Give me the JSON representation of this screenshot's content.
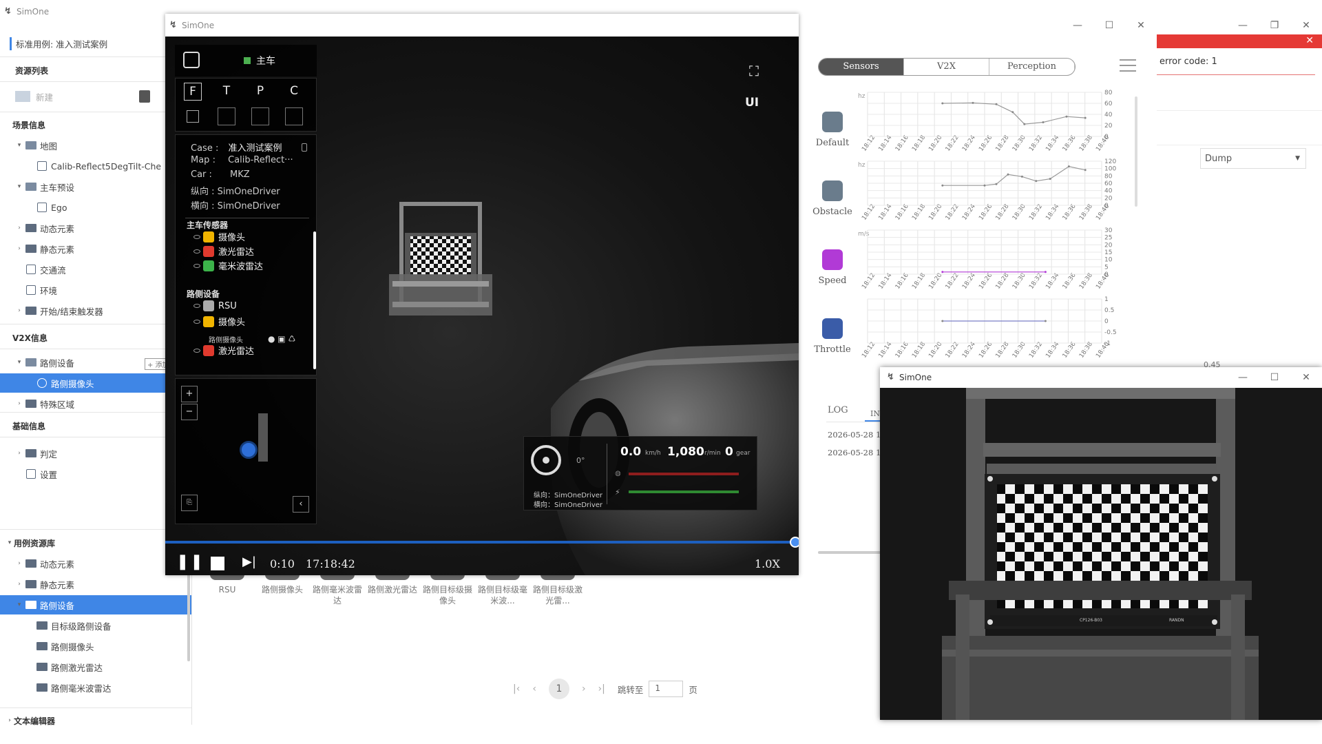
{
  "app": {
    "name": "SimOne"
  },
  "left": {
    "case_title": "标准用例: 准入测试案例",
    "resource_list": "资源列表",
    "new_label": "新建",
    "scene_info": "场景信息",
    "tree": [
      {
        "label": "地图",
        "level": 1,
        "type": "folder-open"
      },
      {
        "label": "Calib-Reflect5DegTilt-Che",
        "level": 2,
        "type": "map"
      },
      {
        "label": "主车预设",
        "level": 1,
        "type": "folder-open"
      },
      {
        "label": "Ego",
        "level": 2,
        "type": "car"
      },
      {
        "label": "动态元素",
        "level": 1,
        "type": "folder"
      },
      {
        "label": "静态元素",
        "level": 1,
        "type": "folder"
      },
      {
        "label": "交通流",
        "level": 1,
        "type": "grid"
      },
      {
        "label": "环境",
        "level": 1,
        "type": "env"
      },
      {
        "label": "开始/结束触发器",
        "level": 1,
        "type": "folder"
      }
    ],
    "v2x_info": "V2X信息",
    "v2x_tree": [
      {
        "label": "路侧设备",
        "level": 1,
        "type": "folder-open"
      },
      {
        "label": "路侧摄像头",
        "level": 2,
        "type": "camera",
        "selected": true
      },
      {
        "label": "特殊区域",
        "level": 1,
        "type": "folder"
      }
    ],
    "base_info": "基础信息",
    "base_tree": [
      {
        "label": "判定",
        "level": 1,
        "type": "folder"
      },
      {
        "label": "设置",
        "level": 1,
        "type": "settings"
      }
    ],
    "case_lib": "用例资源库",
    "lib_tree": [
      {
        "label": "动态元素",
        "level": 1,
        "type": "folder"
      },
      {
        "label": "静态元素",
        "level": 1,
        "type": "folder"
      },
      {
        "label": "路侧设备",
        "level": 1,
        "type": "folder-open",
        "selected": true
      },
      {
        "label": "目标级路侧设备",
        "level": 2,
        "type": "folder"
      },
      {
        "label": "路侧摄像头",
        "level": 2,
        "type": "folder"
      },
      {
        "label": "路侧激光雷达",
        "level": 2,
        "type": "folder"
      },
      {
        "label": "路侧毫米波雷达",
        "level": 2,
        "type": "folder"
      }
    ],
    "text_editor": "文本编辑器",
    "add_tag": "+ 添加"
  },
  "library_items": [
    "RSU",
    "路侧摄像头",
    "路侧毫米波雷达",
    "路侧激光雷达",
    "路侧目标级摄像头",
    "路侧目标级毫米波...",
    "路侧目标级激光雷..."
  ],
  "pagination": {
    "current": "1",
    "goto_label": "跳转至",
    "goto_value": "1",
    "page_suffix": "页"
  },
  "sim": {
    "title": "SimOne",
    "ego_label": "主车",
    "view_modes": [
      "F",
      "T",
      "P",
      "C"
    ],
    "case_key": "Case :",
    "case": "准入测试案例",
    "map_key": "Map :",
    "map": "Calib-Reflect···",
    "car_key": "Car :",
    "car": "MKZ",
    "long_key": "纵向 :",
    "long": "SimOneDriver",
    "lat_key": "横向 :",
    "lat": "SimOneDriver",
    "ego_sensors_title": "主车传感器",
    "ego_sensors": [
      {
        "label": "摄像头",
        "color": "#f0b400"
      },
      {
        "label": "激光雷达",
        "color": "#e03a2e"
      },
      {
        "label": "毫米波雷达",
        "color": "#3cb34a"
      }
    ],
    "road_devices_title": "路侧设备",
    "road_devices": [
      {
        "label": "RSU",
        "color": "#aaaaaa"
      },
      {
        "label": "摄像头",
        "color": "#f0b400"
      },
      {
        "label": "激光雷达",
        "color": "#e03a2e"
      }
    ],
    "road_camera_sub": "路侧摄像头",
    "ui_label": "UI",
    "dash": {
      "angle": "0°",
      "speed": "0.0",
      "speed_unit": "km/h",
      "rpm": "1,080",
      "rpm_unit": "r/min",
      "gear": "0",
      "gear_unit": "gear",
      "long": "纵向：SimOneDriver",
      "lat": "横向：SimOneDriver"
    },
    "time": "0:10",
    "clock": "17:18:42",
    "rate": "1.0X",
    "progress": 0.995
  },
  "charts": {
    "tabs": [
      "Sensors",
      "V2X",
      "Perception"
    ],
    "active_tab": "Sensors",
    "items": [
      {
        "label": "Default",
        "unit": "hz",
        "yticks": [
          "80",
          "60",
          "40",
          "20",
          "0"
        ],
        "color": "#6a7c8c"
      },
      {
        "label": "Obstacle",
        "unit": "hz",
        "yticks": [
          "120",
          "100",
          "80",
          "60",
          "40",
          "20",
          "0"
        ],
        "color": "#6a7c8c"
      },
      {
        "label": "Speed",
        "unit": "m/s",
        "yticks": [
          "30",
          "25",
          "20",
          "15",
          "10",
          "5",
          "0"
        ],
        "color": "#b13ad6"
      },
      {
        "label": "Throttle",
        "unit": "",
        "yticks": [
          "1",
          "0.5",
          "0",
          "-0.5",
          "-1"
        ],
        "color": "#3a5ca8"
      }
    ],
    "xticks": [
      "18:12",
      "18:14",
      "18:16",
      "18:18",
      "18:20",
      "18:22",
      "18:24",
      "18:26",
      "18:28",
      "18:30",
      "18:32",
      "18:34",
      "18:36",
      "18:38",
      "18:40"
    ],
    "log_tab": "LOG",
    "log_tab2": "IN",
    "log_lines": [
      "2026-05-28 1",
      "2026-05-28 1"
    ]
  },
  "error": {
    "text": "error code: 1",
    "dump_label": "Dump",
    "value": "0.45"
  },
  "camera": {
    "title": "SimOne",
    "board_label": "CP126-B03",
    "board_brand": "RANDN"
  }
}
